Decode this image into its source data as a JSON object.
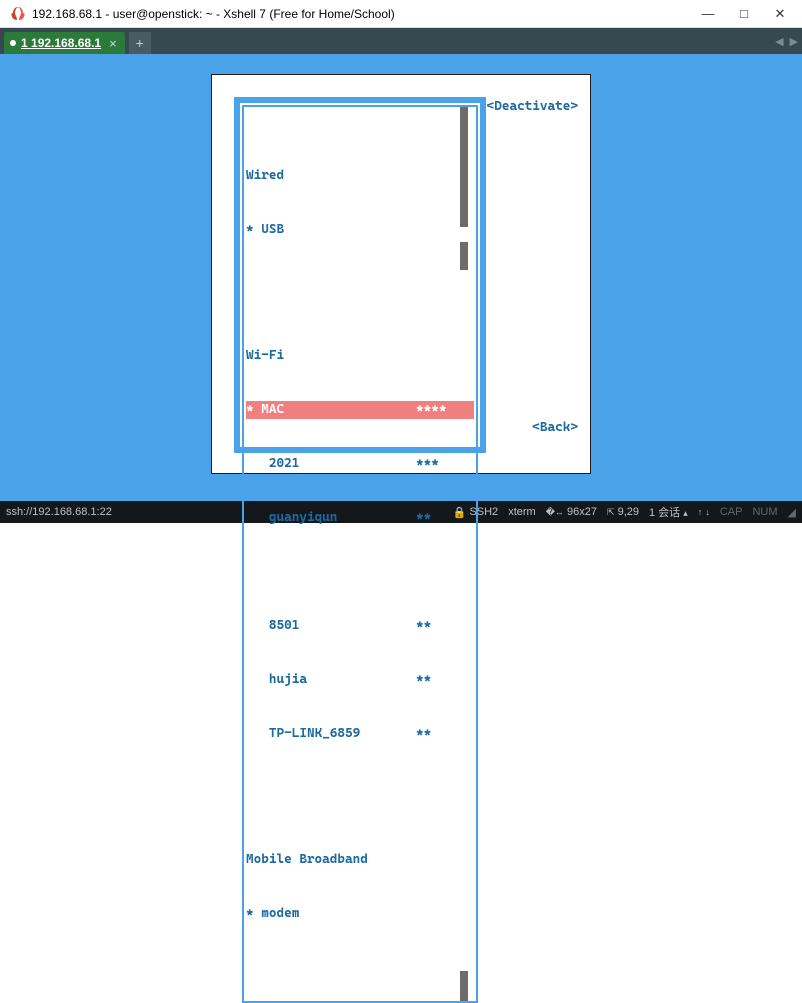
{
  "window": {
    "title": "192.168.68.1 - user@openstick: ~ - Xshell 7 (Free for Home/School)"
  },
  "tabs": {
    "main": {
      "index": "1",
      "label": "192.168.68.1"
    }
  },
  "nmtui": {
    "deactivate": "<Deactivate>",
    "back": "<Back>",
    "sections": {
      "wired": {
        "heading": "Wired",
        "items": [
          {
            "marker": "*",
            "name": "USB",
            "selected": false
          }
        ]
      },
      "wifi": {
        "heading": "Wi-Fi",
        "groups": [
          [
            {
              "marker": "*",
              "name": "MAC",
              "signal": "****",
              "selected": true
            },
            {
              "marker": " ",
              "name": "2021",
              "signal": "***",
              "selected": false
            },
            {
              "marker": " ",
              "name": "guanyiqun",
              "signal": "**",
              "selected": false
            }
          ],
          [
            {
              "marker": " ",
              "name": "8501",
              "signal": "**",
              "selected": false
            },
            {
              "marker": " ",
              "name": "hujia",
              "signal": "**",
              "selected": false
            },
            {
              "marker": " ",
              "name": "TP-LINK_6859",
              "signal": "**",
              "selected": false
            }
          ]
        ]
      },
      "mobile": {
        "heading": "Mobile Broadband",
        "items": [
          {
            "marker": "*",
            "name": "modem",
            "selected": false
          }
        ]
      }
    }
  },
  "status": {
    "addr": "ssh://192.168.68.1:22",
    "ssh": "SSH2",
    "term": "xterm",
    "size": "96x27",
    "cursor": "9,29",
    "sessions": "1 会话",
    "cap": "CAP",
    "num": "NUM"
  }
}
